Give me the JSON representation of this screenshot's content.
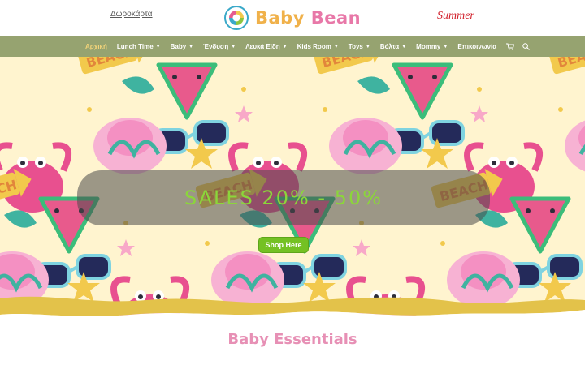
{
  "topbar": {
    "gift_link": "Δωροκάρτα",
    "logo_text_1": "Baby",
    "logo_text_2": "Bean",
    "summer": "Summer"
  },
  "nav": {
    "items": [
      {
        "label": "Αρχική",
        "active": true,
        "dropdown": false
      },
      {
        "label": "Lunch Time",
        "dropdown": true
      },
      {
        "label": "Baby",
        "dropdown": true
      },
      {
        "label": "Ένδυση",
        "dropdown": true
      },
      {
        "label": "Λευκά Είδη",
        "dropdown": true
      },
      {
        "label": "Kids Room",
        "dropdown": true
      },
      {
        "label": "Toys",
        "dropdown": true
      },
      {
        "label": "Βόλτα",
        "dropdown": true
      },
      {
        "label": "Mommy",
        "dropdown": true
      },
      {
        "label": "Επικοινωνία",
        "dropdown": false
      }
    ],
    "icons": [
      "cart-icon",
      "search-icon"
    ]
  },
  "hero": {
    "banner_text": "SALES 20% - 50%",
    "button_label": "Shop Here",
    "pattern_label": "BEACH"
  },
  "section": {
    "title": "Baby Essentials"
  },
  "colors": {
    "nav_bg": "#96a370",
    "active": "#f2d479",
    "button": "#74c123",
    "banner_text": "#8bd63a",
    "title_pink": "#e790b5",
    "sand": "#e3c24a"
  }
}
